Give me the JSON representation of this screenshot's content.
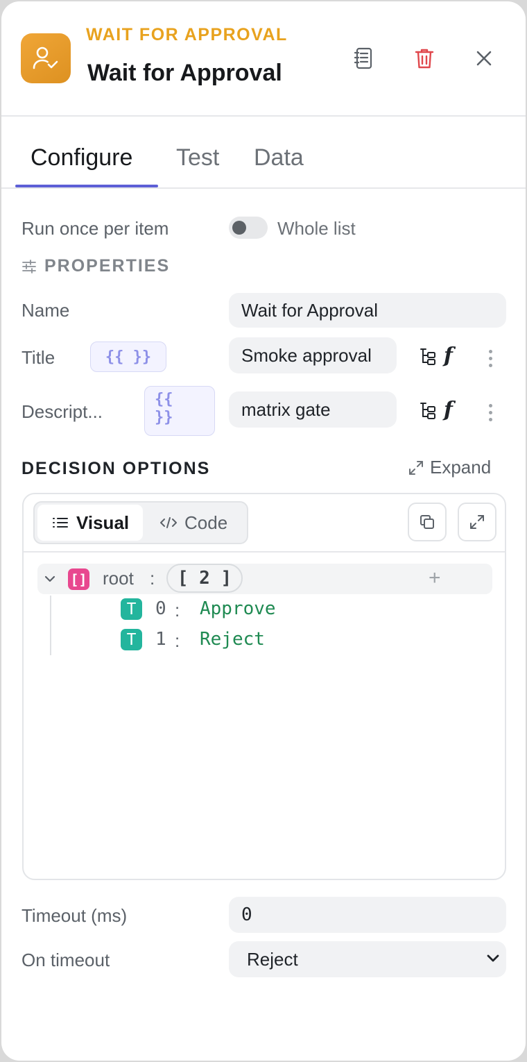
{
  "header": {
    "kicker": "WAIT FOR APPROVAL",
    "title": "Wait for Approval",
    "icon": "user-check-icon",
    "actions": [
      "notes-icon",
      "trash-icon",
      "close-icon"
    ],
    "colors": {
      "brand": "#e8a21e",
      "danger": "#e0474c",
      "tab_accent": "#5d5fd6"
    }
  },
  "tabs": [
    {
      "label": "Configure",
      "active": true
    },
    {
      "label": "Test",
      "active": false
    },
    {
      "label": "Data",
      "active": false
    }
  ],
  "run_mode": {
    "label": "Run once per item",
    "toggle_label": "Whole list",
    "toggle_on": false
  },
  "properties": {
    "heading": "PROPERTIES",
    "name": {
      "label": "Name",
      "value": "Wait for Approval"
    },
    "title": {
      "label": "Title",
      "template_chip": "{{ }}",
      "value": "Smoke approval"
    },
    "description": {
      "label": "Descript...",
      "template_chip_line1": "{{",
      "template_chip_line2": "}}",
      "value": "matrix gate"
    }
  },
  "decision_options": {
    "heading": "DECISION OPTIONS",
    "expand_label": "Expand",
    "view_tabs": {
      "visual": "Visual",
      "code": "Code",
      "active": "visual"
    },
    "tree": {
      "root_key": "root",
      "colon": ":",
      "count_label": "[ 2 ]",
      "add_symbol": "+",
      "items": [
        {
          "index": "0",
          "value": "Approve"
        },
        {
          "index": "1",
          "value": "Reject"
        }
      ]
    }
  },
  "timeout": {
    "label": "Timeout (ms)",
    "value": "0"
  },
  "on_timeout": {
    "label": "On timeout",
    "selected": "Reject"
  }
}
